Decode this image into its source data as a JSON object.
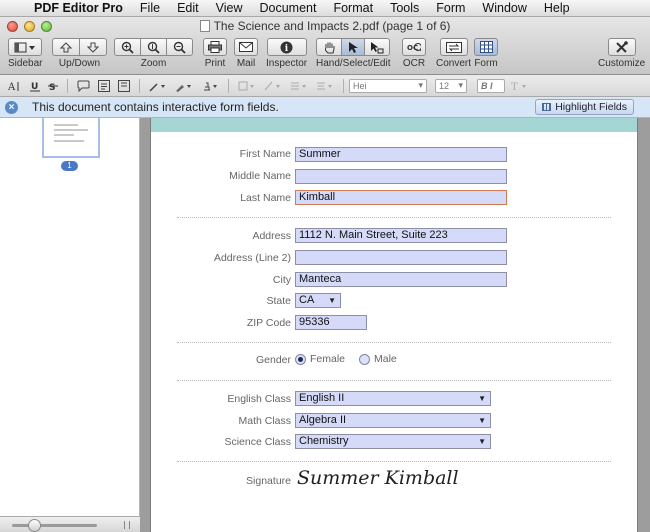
{
  "menubar": {
    "apple": "",
    "items": [
      "PDF Editor Pro",
      "File",
      "Edit",
      "View",
      "Document",
      "Format",
      "Tools",
      "Form",
      "Window",
      "Help"
    ]
  },
  "window": {
    "title": "The Science and Impacts 2.pdf (page 1 of 6)"
  },
  "toolbar": {
    "sidebar": "Sidebar",
    "updown": "Up/Down",
    "zoom": "Zoom",
    "print": "Print",
    "mail": "Mail",
    "inspector": "Inspector",
    "hand_select_edit": "Hand/Select/Edit",
    "ocr": "OCR",
    "convert": "Convert",
    "form": "Form",
    "customize": "Customize"
  },
  "formatbar": {
    "font": "Hei",
    "size": "12",
    "bi": "B I"
  },
  "notice": {
    "message": "This document contains interactive form fields.",
    "button": "Highlight Fields"
  },
  "sidebar": {
    "page_badge": "1"
  },
  "form": {
    "first_name": {
      "label": "First Name",
      "value": "Summer"
    },
    "middle_name": {
      "label": "Middle Name",
      "value": ""
    },
    "last_name": {
      "label": "Last Name",
      "value": "Kimball"
    },
    "address": {
      "label": "Address",
      "value": "1112 N. Main Street, Suite 223"
    },
    "address2": {
      "label": "Address (Line 2)",
      "value": ""
    },
    "city": {
      "label": "City",
      "value": "Manteca"
    },
    "state": {
      "label": "State",
      "value": "CA"
    },
    "zip": {
      "label": "ZIP Code",
      "value": "95336"
    },
    "gender": {
      "label": "Gender",
      "options": [
        "Female",
        "Male"
      ],
      "selected": "Female"
    },
    "english": {
      "label": "English Class",
      "value": "English II"
    },
    "math": {
      "label": "Math Class",
      "value": "Algebra II"
    },
    "science": {
      "label": "Science Class",
      "value": "Chemistry"
    },
    "signature": {
      "label": "Signature",
      "value": "Summer Kimball"
    }
  }
}
